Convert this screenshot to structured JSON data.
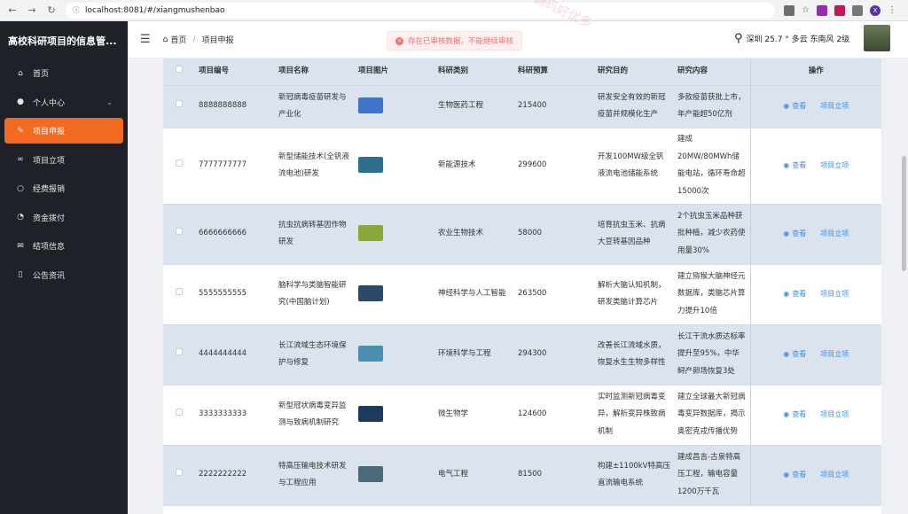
{
  "browser": {
    "url": "localhost:8081/#/xiangmushenbao",
    "profile_initial": "X"
  },
  "sidebar": {
    "title": "高校科研项目的信息管...",
    "items": [
      {
        "label": "首页",
        "icon": "home-icon"
      },
      {
        "label": "个人中心",
        "icon": "user-icon",
        "has_children": true
      },
      {
        "label": "项目申报",
        "icon": "edit-icon",
        "active": true
      },
      {
        "label": "项目立项",
        "icon": "link-icon"
      },
      {
        "label": "经费报销",
        "icon": "chat-icon"
      },
      {
        "label": "资金拨付",
        "icon": "clock-icon"
      },
      {
        "label": "结项信息",
        "icon": "mail-icon"
      },
      {
        "label": "公告资讯",
        "icon": "book-icon"
      }
    ]
  },
  "header": {
    "breadcrumb_home": "首页",
    "breadcrumb_current": "项目申报",
    "alert": "存在已审核数据，不能继续审核",
    "weather": "深圳  25.7 °  多云  东南风  2级"
  },
  "table": {
    "columns": [
      "项目编号",
      "项目名称",
      "项目图片",
      "科研类别",
      "科研预算",
      "研究目的",
      "研究内容",
      "操作"
    ],
    "view_label": "查看",
    "approve_label": "项目立项",
    "rows": [
      {
        "id": "8888888888",
        "name": "新冠病毒疫苗研发与产业化",
        "category": "生物医药工程",
        "budget": "215400",
        "purpose": "研发安全有效的新冠疫苗并规模化生产",
        "content": "多款疫苗获批上市，年产能超50亿剂",
        "thumb": "#3f74c9"
      },
      {
        "id": "7777777777",
        "name": "新型储能技术(全钒液流电池)研发",
        "category": "新能源技术",
        "budget": "299600",
        "purpose": "开发100MW级全钒液流电池储能系统",
        "content": "建成20MW/80MWh储能电站，循环寿命超15000次",
        "thumb": "#2e6e8e"
      },
      {
        "id": "6666666666",
        "name": "抗虫抗病转基因作物研发",
        "category": "农业生物技术",
        "budget": "58000",
        "purpose": "培育抗虫玉米、抗病大豆转基因品种",
        "content": "2个抗虫玉米品种获批种植，减少农药使用量30%",
        "thumb": "#8aa83c"
      },
      {
        "id": "5555555555",
        "name": "脑科学与类脑智能研究(中国脑计划)",
        "category": "神经科学与人工智能",
        "budget": "263500",
        "purpose": "解析大脑认知机制，研发类脑计算芯片",
        "content": "建立猕猴大脑神经元数据库，类脑芯片算力提升10倍",
        "thumb": "#2a4a6a"
      },
      {
        "id": "4444444444",
        "name": "长江流域生态环境保护与修复",
        "category": "环境科学与工程",
        "budget": "294300",
        "purpose": "改善长江流域水质，恢复水生生物多样性",
        "content": "长江干流水质达标率提升至95%，中华鲟产卵场恢复3处",
        "thumb": "#4a8fb0"
      },
      {
        "id": "3333333333",
        "name": "新型冠状病毒变异监测与致病机制研究",
        "category": "微生物学",
        "budget": "124600",
        "purpose": "实时监测新冠病毒变异，解析变异株致病机制",
        "content": "建立全球最大新冠病毒变异数据库，揭示奥密克戎传播优势",
        "thumb": "#1f3a5a"
      },
      {
        "id": "2222222222",
        "name": "特高压输电技术研发与工程应用",
        "category": "电气工程",
        "budget": "81500",
        "purpose": "构建±1100kV特高压直流输电系统",
        "content": "建成昌吉-古泉特高压工程，输电容量1200万千瓦",
        "thumb": "#4a6a7a"
      }
    ]
  }
}
